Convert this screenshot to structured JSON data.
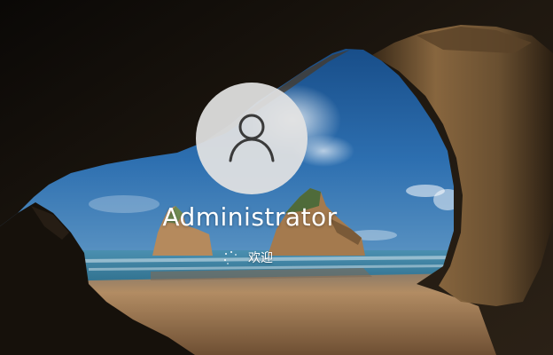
{
  "lock_screen": {
    "user_name": "Administrator",
    "status_text": "欢迎",
    "avatar_icon": "user-icon",
    "spinner_icon": "loading-spinner-icon",
    "background_image": "sea-cave-beach-wallpaper"
  },
  "colors": {
    "avatar_background": "#e2e2e2",
    "avatar_glyph": "#3a3a3a",
    "text": "#ffffff",
    "sky": "#2d6fb0",
    "sea": "#3b86a6",
    "sand": "#b58a5d",
    "cave": "#1b150f"
  }
}
